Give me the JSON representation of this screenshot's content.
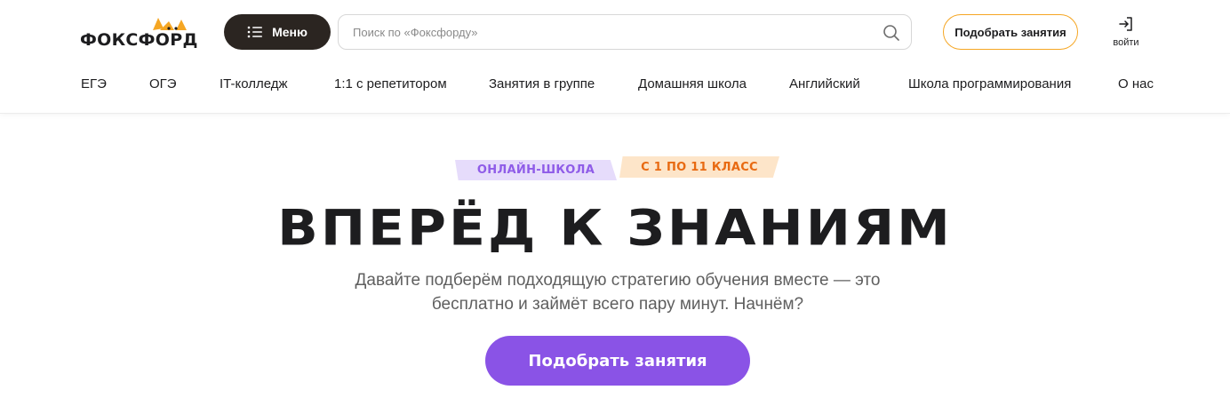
{
  "header": {
    "logo_text": "ФОКСФОРД",
    "menu_label": "Меню",
    "search": {
      "placeholder": "Поиск по «Фоксфорду»",
      "value": ""
    },
    "pick_label": "Подобрать занятия",
    "login_label": "войти"
  },
  "nav": {
    "items": [
      "ЕГЭ",
      "ОГЭ",
      "IT-колледж",
      "1:1 с репетитором",
      "Занятия в группе",
      "Домашняя школа",
      "Английский",
      "Школа программирования",
      "О нас"
    ]
  },
  "hero": {
    "tag_online": "ОНЛАЙН-ШКОЛА",
    "tag_grade": "С 1 ПО 11 КЛАСС",
    "headline": "ВПЕРЁД К ЗНАНИЯМ",
    "subtitle": "Давайте подберём подходящую стратегию обучения вместе — это бесплатно и займёт всего пару минут. Начнём?",
    "cta_label": "Подобрать занятия"
  },
  "colors": {
    "dark": "#2b2521",
    "accent_orange": "#f5a623",
    "purple": "#8a53e6",
    "purple_light": "#e6dcfb",
    "orange_light": "#fde5c9",
    "orange_text": "#e86a12"
  },
  "icons": {
    "menu": "list-icon",
    "search": "search-icon",
    "login": "login-arrow-icon"
  }
}
